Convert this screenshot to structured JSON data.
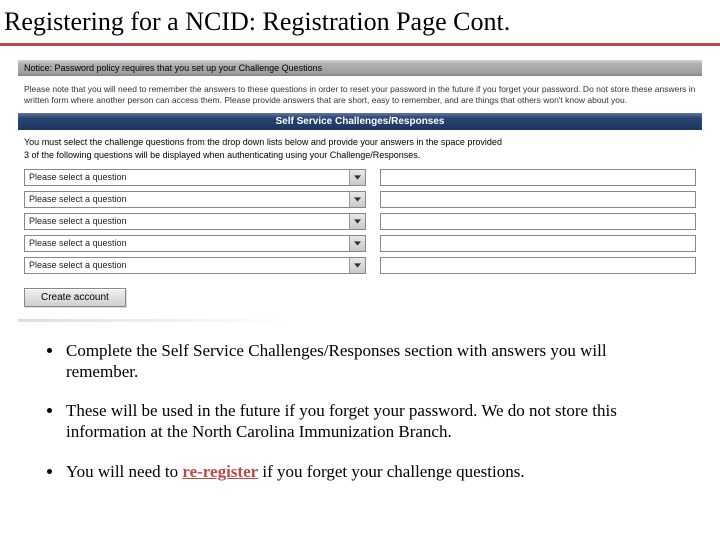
{
  "title": "Registering for a NCID: Registration Page Cont.",
  "notice_bar": "Notice: Password policy requires that you set up your Challenge Questions",
  "policy_line1": "Please note that you will need to remember the answers to these questions in order to reset your password in the future if you forget your password. Do not store these answers in written form where another person can access them. Please provide answers that are short, easy to remember, and are things that others won't know about you.",
  "section_header": "Self Service Challenges/Responses",
  "instruction1": "You must select the challenge questions from the drop down lists below and provide your answers in the space provided",
  "instruction2": "3 of the following questions will be displayed when authenticating using your Challenge/Responses.",
  "select_placeholder": "Please select a question",
  "rows": [
    0,
    1,
    2,
    3,
    4
  ],
  "create_button": "Create account",
  "bullets": [
    {
      "text": "Complete the Self Service Challenges/Responses section with answers you will remember."
    },
    {
      "text": "These will be used in the future if you forget your password. We do not store this information at the North Carolina Immunization Branch."
    },
    {
      "text_pre": "You will need to ",
      "emph": "re-register",
      "text_post": " if you forget your challenge questions."
    }
  ]
}
